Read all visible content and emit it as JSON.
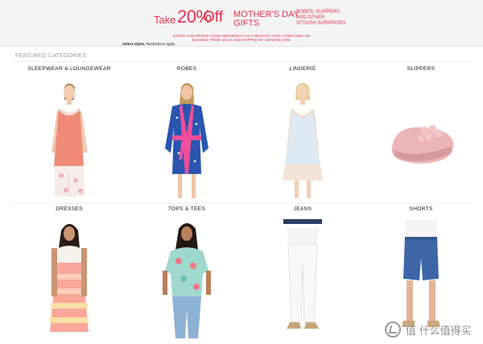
{
  "banner": {
    "take": "Take",
    "percent": "20%",
    "off": "Off",
    "title_line1": "MOTHER'S DAY",
    "title_line2": "GIFTS",
    "sub_line1": "ROBES, SLIPPERS,",
    "sub_line2": "AND OTHER",
    "sub_line3": "STYLISH SURPRISES",
    "fine_print_line1": "ENTER THE PROMO CODE 20MOMSDAY AT CHECKOUT FOR A DISCOUNT ON",
    "fine_print_line2": "ELIGIBLE ITEMS SOLD AND SHIPPED BY AMAZON.COM.",
    "select_bold": "Select styles.",
    "select_rest": "Restrictions apply."
  },
  "section": {
    "title": "FEATURED CATEGORIES"
  },
  "categories": [
    {
      "label": "SLEEPWEAR & LOUNGEWEAR"
    },
    {
      "label": "ROBES"
    },
    {
      "label": "LINGERIE"
    },
    {
      "label": "SLIPPERS"
    },
    {
      "label": "DRESSES"
    },
    {
      "label": "TOPS & TEES"
    },
    {
      "label": "JEANS"
    },
    {
      "label": "SHORTS"
    }
  ],
  "watermark": {
    "text": "值 什么值得买"
  },
  "colors": {
    "accent": "#e4314f",
    "text": "#111111",
    "muted": "#999999",
    "banner_bg": "#f4f4f4"
  }
}
